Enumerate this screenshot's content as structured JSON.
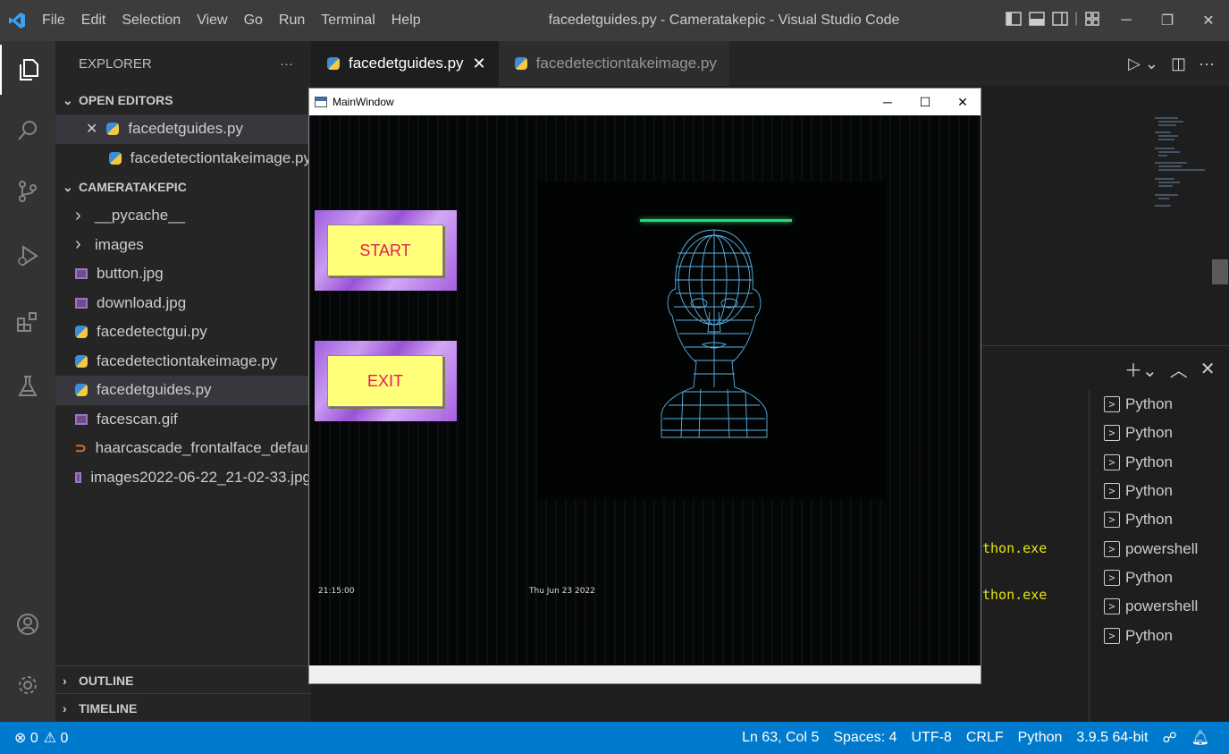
{
  "titlebar": {
    "menu": [
      "File",
      "Edit",
      "Selection",
      "View",
      "Go",
      "Run",
      "Terminal",
      "Help"
    ],
    "title": "facedetguides.py - Cameratakepic - Visual Studio Code"
  },
  "sidebar": {
    "header": "EXPLORER",
    "more": "···",
    "open_editors_label": "OPEN EDITORS",
    "open_editors": [
      {
        "name": "facedetguides.py",
        "close": "✕"
      },
      {
        "name": "facedetectiontakeimage.py"
      }
    ],
    "project_label": "CAMERATAKEPIC",
    "tree": [
      {
        "name": "__pycache__",
        "type": "folder"
      },
      {
        "name": "images",
        "type": "folder"
      },
      {
        "name": "button.jpg",
        "type": "image"
      },
      {
        "name": "download.jpg",
        "type": "image"
      },
      {
        "name": "facedetectgui.py",
        "type": "python"
      },
      {
        "name": "facedetectiontakeimage.py",
        "type": "python"
      },
      {
        "name": "facedetguides.py",
        "type": "python",
        "selected": true
      },
      {
        "name": "facescan.gif",
        "type": "image"
      },
      {
        "name": "haarcascade_frontalface_defaul...",
        "type": "xml"
      },
      {
        "name": "images2022-06-22_21-02-33.jpg",
        "type": "image"
      }
    ],
    "outline_label": "OUTLINE",
    "timeline_label": "TIMELINE"
  },
  "tabs": [
    {
      "label": "facedetguides.py",
      "active": true
    },
    {
      "label": "facedetectiontakeimage.py",
      "active": false
    }
  ],
  "terminal": {
    "output_lines": [
      "thon.exe",
      "thon.exe"
    ],
    "instances": [
      "Python",
      "Python",
      "Python",
      "Python",
      "Python",
      "powershell",
      "Python",
      "powershell",
      "Python"
    ]
  },
  "statusbar": {
    "errors": "⊗ 0",
    "warnings": "⚠ 0",
    "position": "Ln 63, Col 5",
    "spaces": "Spaces: 4",
    "encoding": "UTF-8",
    "eol": "CRLF",
    "language": "Python",
    "interpreter": "3.9.5 64-bit"
  },
  "app_window": {
    "title": "MainWindow",
    "start_label": "START",
    "exit_label": "EXIT",
    "time": "21:15:00",
    "date": "Thu Jun 23 2022"
  },
  "colors": {
    "accent": "#007acc",
    "button_fill": "#ffff7a",
    "button_text": "#e8185a",
    "scan_line": "#2ad57a",
    "mesh": "#5ab4e8"
  }
}
